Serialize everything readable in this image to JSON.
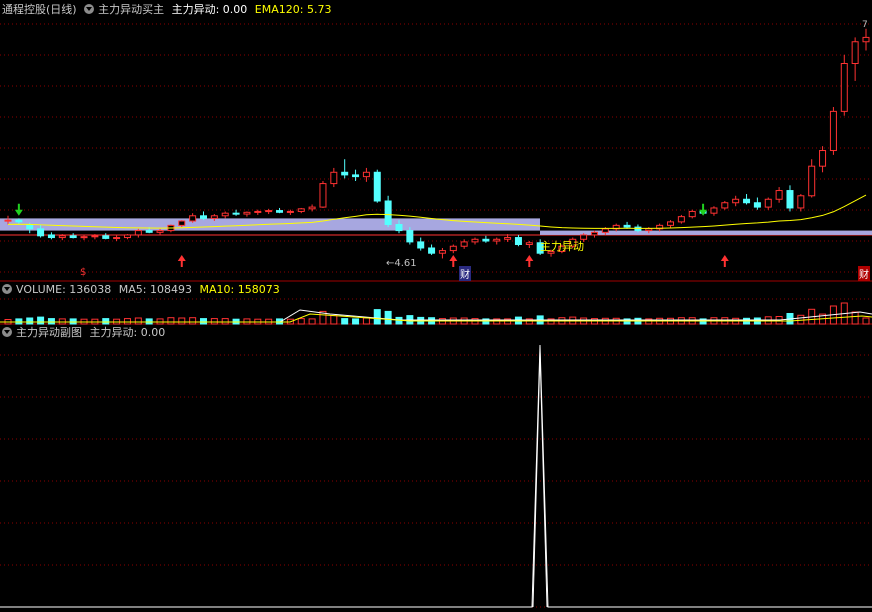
{
  "main_panel": {
    "title": "通程控股(日线)",
    "indicator_name": "主力异动买主",
    "readouts": [
      {
        "label": "主力异动: 0.00",
        "color": "#ffffff"
      },
      {
        "label": "EMA120: 5.73",
        "color": "#ffff00"
      }
    ],
    "annotations": {
      "signal_label": "主力异动",
      "low_marker": "4.61",
      "high_marker": "7",
      "fin_label_left": "$",
      "fin_label_mid": "财",
      "fin_label_right": "财"
    }
  },
  "volume_panel": {
    "title": "VOLUME: 136038",
    "ma5": "MA5: 108493",
    "ma10": "MA10: 158073"
  },
  "sub_panel": {
    "title": "主力异动副图",
    "readout": "主力异动: 0.00"
  },
  "colors": {
    "up": "#ff3232",
    "down": "#54ffff",
    "band": "#a7a7e0",
    "ema": "#ffff00",
    "grid": "#8b0000",
    "magenta": "#ff00ff",
    "white": "#ffffff"
  },
  "chart_data": {
    "type": "candlestick",
    "ema120_last": 5.73,
    "low_marker": 4.61,
    "candles": [
      [
        5.5,
        5.55,
        5.45,
        5.5
      ],
      [
        5.5,
        5.52,
        5.45,
        5.48
      ],
      [
        5.45,
        5.47,
        5.35,
        5.4
      ],
      [
        5.4,
        5.45,
        5.3,
        5.32
      ],
      [
        5.33,
        5.36,
        5.28,
        5.3
      ],
      [
        5.3,
        5.34,
        5.27,
        5.32
      ],
      [
        5.32,
        5.35,
        5.29,
        5.3
      ],
      [
        5.3,
        5.33,
        5.27,
        5.31
      ],
      [
        5.31,
        5.34,
        5.28,
        5.32
      ],
      [
        5.32,
        5.35,
        5.28,
        5.29
      ],
      [
        5.29,
        5.33,
        5.26,
        5.3
      ],
      [
        5.3,
        5.34,
        5.28,
        5.33
      ],
      [
        5.33,
        5.4,
        5.3,
        5.38
      ],
      [
        5.38,
        5.42,
        5.35,
        5.36
      ],
      [
        5.36,
        5.4,
        5.33,
        5.38
      ],
      [
        5.38,
        5.45,
        5.36,
        5.44
      ],
      [
        5.44,
        5.5,
        5.42,
        5.49
      ],
      [
        5.49,
        5.58,
        5.47,
        5.55
      ],
      [
        5.55,
        5.6,
        5.5,
        5.52
      ],
      [
        5.52,
        5.57,
        5.49,
        5.55
      ],
      [
        5.55,
        5.6,
        5.52,
        5.58
      ],
      [
        5.58,
        5.62,
        5.55,
        5.57
      ],
      [
        5.57,
        5.6,
        5.54,
        5.59
      ],
      [
        5.59,
        5.62,
        5.56,
        5.6
      ],
      [
        5.6,
        5.63,
        5.57,
        5.61
      ],
      [
        5.61,
        5.64,
        5.58,
        5.59
      ],
      [
        5.59,
        5.62,
        5.56,
        5.6
      ],
      [
        5.6,
        5.64,
        5.58,
        5.63
      ],
      [
        5.63,
        5.68,
        5.6,
        5.65
      ],
      [
        5.65,
        5.95,
        5.64,
        5.92
      ],
      [
        5.92,
        6.1,
        5.88,
        6.05
      ],
      [
        6.05,
        6.2,
        5.98,
        6.02
      ],
      [
        6.02,
        6.08,
        5.95,
        6.0
      ],
      [
        6.0,
        6.1,
        5.94,
        6.05
      ],
      [
        6.05,
        6.08,
        5.7,
        5.72
      ],
      [
        5.72,
        5.78,
        5.42,
        5.45
      ],
      [
        5.45,
        5.5,
        5.35,
        5.38
      ],
      [
        5.38,
        5.42,
        5.22,
        5.25
      ],
      [
        5.25,
        5.3,
        5.15,
        5.18
      ],
      [
        5.18,
        5.22,
        5.1,
        5.12
      ],
      [
        5.12,
        5.18,
        5.06,
        5.15
      ],
      [
        5.15,
        5.22,
        5.12,
        5.2
      ],
      [
        5.2,
        5.28,
        5.17,
        5.25
      ],
      [
        5.25,
        5.3,
        5.22,
        5.28
      ],
      [
        5.28,
        5.32,
        5.24,
        5.26
      ],
      [
        5.26,
        5.3,
        5.22,
        5.28
      ],
      [
        5.28,
        5.34,
        5.25,
        5.3
      ],
      [
        5.3,
        5.33,
        5.2,
        5.22
      ],
      [
        5.22,
        5.26,
        5.18,
        5.24
      ],
      [
        5.24,
        5.28,
        5.1,
        5.12
      ],
      [
        5.12,
        5.16,
        5.08,
        5.14
      ],
      [
        5.14,
        5.22,
        5.12,
        5.2
      ],
      [
        5.2,
        5.3,
        5.18,
        5.28
      ],
      [
        5.28,
        5.35,
        5.25,
        5.33
      ],
      [
        5.33,
        5.38,
        5.3,
        5.36
      ],
      [
        5.36,
        5.42,
        5.33,
        5.4
      ],
      [
        5.4,
        5.46,
        5.37,
        5.44
      ],
      [
        5.44,
        5.48,
        5.4,
        5.42
      ],
      [
        5.42,
        5.45,
        5.36,
        5.38
      ],
      [
        5.38,
        5.42,
        5.35,
        5.4
      ],
      [
        5.4,
        5.46,
        5.37,
        5.44
      ],
      [
        5.44,
        5.5,
        5.41,
        5.48
      ],
      [
        5.48,
        5.56,
        5.46,
        5.54
      ],
      [
        5.54,
        5.62,
        5.52,
        5.6
      ],
      [
        5.6,
        5.66,
        5.56,
        5.58
      ],
      [
        5.58,
        5.66,
        5.55,
        5.64
      ],
      [
        5.64,
        5.72,
        5.62,
        5.7
      ],
      [
        5.7,
        5.78,
        5.66,
        5.74
      ],
      [
        5.74,
        5.8,
        5.68,
        5.7
      ],
      [
        5.7,
        5.76,
        5.62,
        5.65
      ],
      [
        5.65,
        5.76,
        5.62,
        5.74
      ],
      [
        5.74,
        5.88,
        5.7,
        5.84
      ],
      [
        5.84,
        5.9,
        5.6,
        5.64
      ],
      [
        5.64,
        5.8,
        5.6,
        5.78
      ],
      [
        5.78,
        6.2,
        5.76,
        6.12
      ],
      [
        6.12,
        6.35,
        6.05,
        6.3
      ],
      [
        6.3,
        6.8,
        6.25,
        6.75
      ],
      [
        6.75,
        7.4,
        6.7,
        7.3
      ],
      [
        7.3,
        7.6,
        7.1,
        7.55
      ],
      [
        7.55,
        7.7,
        7.45,
        7.6
      ]
    ]
  }
}
